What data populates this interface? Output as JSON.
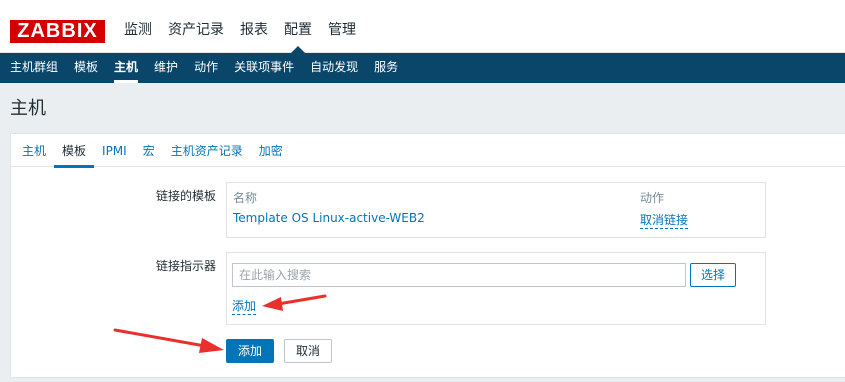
{
  "header": {
    "logo": "ZABBIX",
    "menu": [
      "监测",
      "资产记录",
      "报表",
      "配置",
      "管理"
    ],
    "active_menu": "配置"
  },
  "subnav": {
    "items": [
      "主机群组",
      "模板",
      "主机",
      "维护",
      "动作",
      "关联项事件",
      "自动发现",
      "服务"
    ],
    "active": "主机"
  },
  "page": {
    "title": "主机"
  },
  "tabs": {
    "items": [
      "主机",
      "模板",
      "IPMI",
      "宏",
      "主机资产记录",
      "加密"
    ],
    "active": "模板"
  },
  "linked_templates": {
    "label": "链接的模板",
    "col_name": "名称",
    "col_action": "动作",
    "rows": [
      {
        "name": "Template OS Linux-active-WEB2",
        "action": "取消链接"
      }
    ]
  },
  "link_indicator": {
    "label": "链接指示器",
    "placeholder": "在此输入搜索",
    "select_button": "选择",
    "add_link": "添加"
  },
  "form_buttons": {
    "add": "添加",
    "cancel": "取消"
  },
  "colors": {
    "accent": "#0275b8",
    "nav": "#0a466a",
    "logo": "#d40000",
    "annotation_arrow": "#e8302c"
  }
}
